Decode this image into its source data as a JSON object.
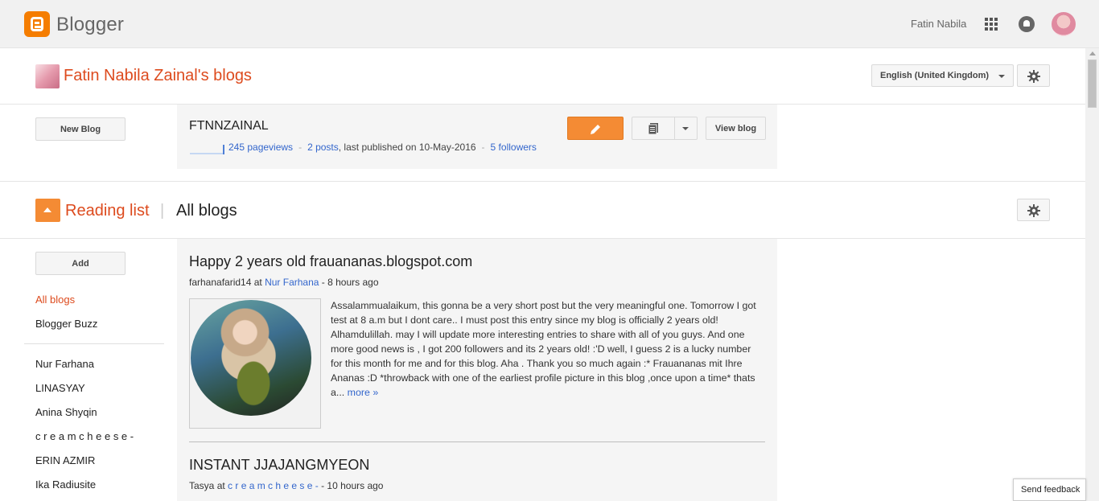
{
  "topbar": {
    "logo_text": "Blogger",
    "user_name": "Fatin Nabila",
    "icons": [
      "apps-grid-icon",
      "notifications-bell-icon",
      "user-avatar"
    ]
  },
  "blogs_header": {
    "title": "Fatin Nabila Zainal's blogs",
    "language": "English (United Kingdom)"
  },
  "blog_section": {
    "new_blog_label": "New Blog",
    "blog": {
      "name": "FTNNZAINAL",
      "pageviews": "245 pageviews",
      "posts": "2 posts",
      "last_published": ", last published on 10-May-2016",
      "followers": "5 followers",
      "sep": "-"
    },
    "view_blog_label": "View blog"
  },
  "reading_list": {
    "title": "Reading list",
    "pipe": "|",
    "subtitle": "All blogs",
    "add_label": "Add",
    "side_links": [
      "All blogs",
      "Blogger Buzz"
    ],
    "followed_blogs": [
      "Nur Farhana",
      "LINASYAY",
      "Anina Shyqin",
      "c r e a m c h e e s e -",
      "ERIN AZMIR",
      "Ika Radiusite"
    ]
  },
  "posts": [
    {
      "title": "Happy 2 years old frauananas.blogspot.com",
      "author": "farhanafarid14",
      "at": " at ",
      "blog": "Nur Farhana",
      "age": " - 8 hours ago",
      "excerpt": "Assalammualaikum, this gonna be a very short post but the very meaningful one. Tomorrow I got test at 8 a.m but I dont care.. I must post this entry since my blog is officially 2 years old! Alhamdulillah. may I will update more interesting entries to share with all of you guys. And one more good news is , I got 200 followers and its 2 years old! :'D well, I guess 2 is a lucky number for this month for me and for this blog. Aha . Thank you so much again :* Frauananas mit Ihre Ananas :D *throwback with one of the earliest profile picture in this blog ,once upon a time* thats a...",
      "more": "more »"
    },
    {
      "title": "INSTANT JJAJANGMYEON",
      "author": "Tasya",
      "at": " at ",
      "blog": "c r e a m c h e e s e -",
      "age": " - 10 hours ago"
    }
  ],
  "feedback_label": "Send feedback",
  "colors": {
    "accent": "#f48b34",
    "title_orange": "#dd4b1e",
    "link_blue": "#3366cc"
  }
}
